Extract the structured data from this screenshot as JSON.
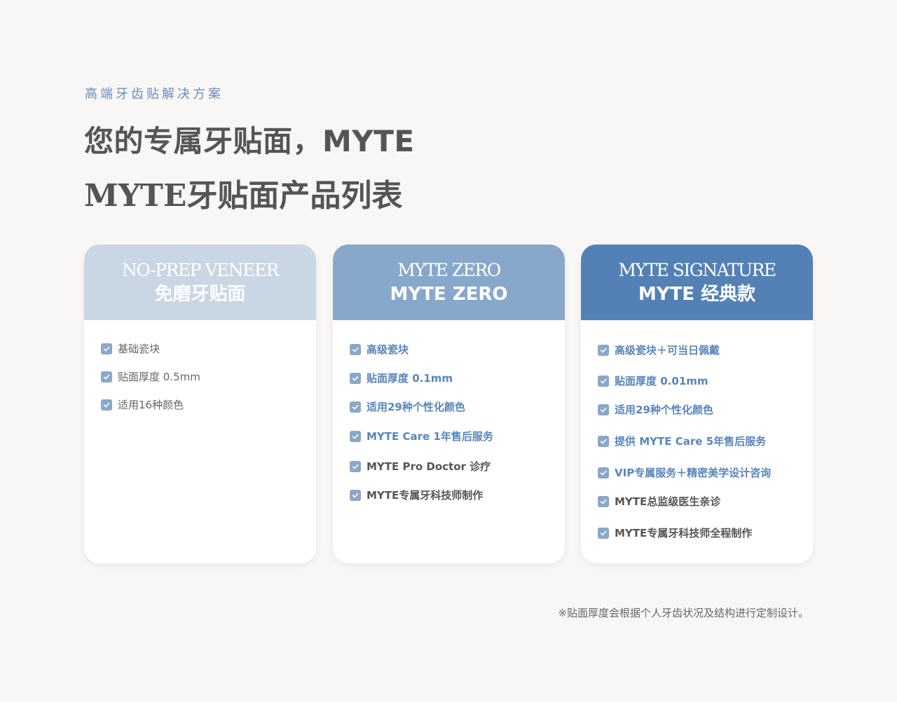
{
  "header": {
    "eyebrow": "高端牙齿贴解决方案",
    "headline": "您的专属牙贴面，MYTE",
    "subtitle": "MYTE牙贴面产品列表"
  },
  "cards": [
    {
      "en_title": "NO-PREP VENEER",
      "cn_title": "免磨牙贴面",
      "header_color": "#c9d6e3",
      "features": [
        {
          "text": "基础瓷块",
          "tone": "regular"
        },
        {
          "text": "贴面厚度 0.5mm",
          "tone": "regular"
        },
        {
          "text": "适用16种颜色",
          "tone": "regular"
        }
      ]
    },
    {
      "en_title": "MYTE ZERO",
      "cn_title": "MYTE ZERO",
      "header_color": "#88a8cb",
      "features": [
        {
          "text": "高级瓷块",
          "tone": "blue"
        },
        {
          "text": "贴面厚度 0.1mm",
          "tone": "blue"
        },
        {
          "text": "适用29种个性化颜色",
          "tone": "blue"
        },
        {
          "text": "MYTE Care 1年售后服务",
          "tone": "blue"
        },
        {
          "text": "MYTE Pro Doctor 诊疗",
          "tone": "grey"
        },
        {
          "text": "MYTE专属牙科技师制作",
          "tone": "grey"
        }
      ]
    },
    {
      "en_title": "MYTE SIGNATURE",
      "cn_title": "MYTE 经典款",
      "header_color": "#5481b5",
      "features": [
        {
          "text": "高级瓷块＋可当日佩戴",
          "tone": "blue"
        },
        {
          "text": "贴面厚度 0.01mm",
          "tone": "blue"
        },
        {
          "text": "适用29种个性化颜色",
          "tone": "blue"
        },
        {
          "text": "提供 MYTE Care 5年售后服务",
          "tone": "blue"
        },
        {
          "text": "VIP专属服务＋精密美学设计咨询",
          "tone": "blue"
        },
        {
          "text": "MYTE总监级医生亲诊",
          "tone": "grey"
        },
        {
          "text": "MYTE专属牙科技师全程制作",
          "tone": "grey"
        }
      ]
    }
  ],
  "footnote": "※贴面厚度会根据个人牙齿状况及结构进行定制设计。",
  "colors": {
    "background": "#f9f7f5",
    "accent_blue": "#5a85ba",
    "text_grey": "#555555",
    "check_fill": "#8aa7c8"
  }
}
